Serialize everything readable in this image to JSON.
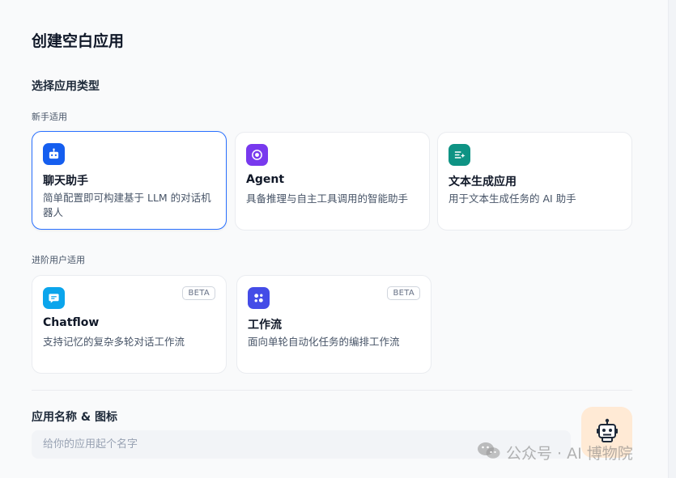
{
  "page": {
    "title": "创建空白应用",
    "section_title": "选择应用类型"
  },
  "groups": {
    "beginner": "新手适用",
    "advanced": "进阶用户适用"
  },
  "cards": {
    "chatbot": {
      "title": "聊天助手",
      "desc": "简单配置即可构建基于 LLM 的对话机器人",
      "icon": "robot-icon",
      "color": "#155eef"
    },
    "agent": {
      "title": "Agent",
      "desc": "具备推理与自主工具调用的智能助手",
      "icon": "agent-icon",
      "color": "#7839ee"
    },
    "completion": {
      "title": "文本生成应用",
      "desc": "用于文本生成任务的 AI 助手",
      "icon": "text-generation-icon",
      "color": "#0e9384"
    },
    "chatflow": {
      "title": "Chatflow",
      "desc": "支持记忆的复杂多轮对话工作流",
      "badge": "BETA",
      "icon": "chat-bubble-icon",
      "color": "#0ba5ec"
    },
    "workflow": {
      "title": "工作流",
      "desc": "面向单轮自动化任务的编排工作流",
      "badge": "BETA",
      "icon": "workflow-icon",
      "color": "#444ce7"
    }
  },
  "app_name": {
    "label": "应用名称 & 图标",
    "placeholder": "给你的应用起个名字",
    "value": ""
  },
  "app_icon": {
    "name": "robot-face-icon",
    "background": "#ffead5"
  },
  "watermark": {
    "text": "公众号 · AI 博物院",
    "icon": "wechat-icon"
  }
}
